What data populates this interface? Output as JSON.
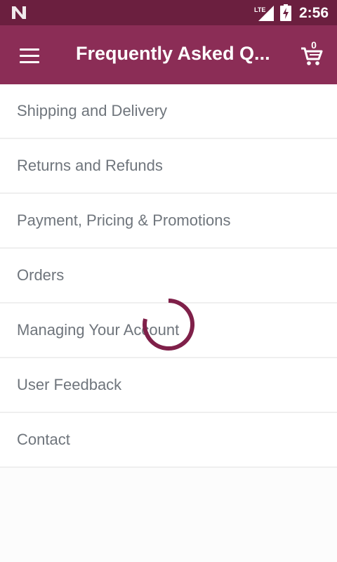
{
  "status_bar": {
    "time": "2:56",
    "network": "LTE"
  },
  "app_bar": {
    "title": "Frequently Asked Q...",
    "cart_count": "0"
  },
  "faq": {
    "items": [
      {
        "label": "Shipping and Delivery"
      },
      {
        "label": "Returns and Refunds"
      },
      {
        "label": "Payment, Pricing & Promotions"
      },
      {
        "label": "Orders"
      },
      {
        "label": "Managing Your Account"
      },
      {
        "label": "User Feedback"
      },
      {
        "label": "Contact"
      }
    ]
  },
  "colors": {
    "status_bar": "#6b1f3f",
    "app_bar": "#8b2d56",
    "spinner": "#7f2049",
    "text": "#6f757c"
  },
  "loading": true
}
